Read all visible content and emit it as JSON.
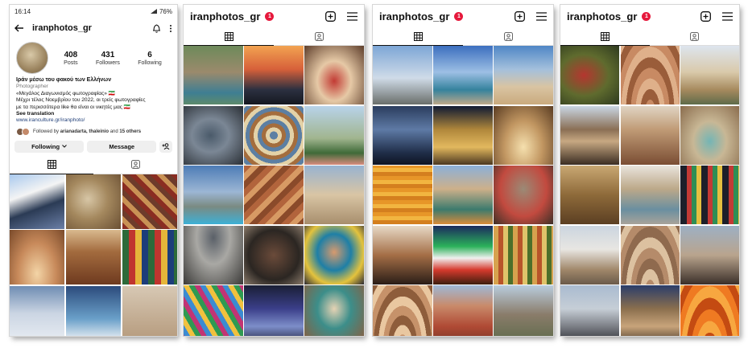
{
  "status": {
    "time": "16:14",
    "battery": "76%"
  },
  "profile": {
    "username": "iranphotos_gr",
    "stats": [
      {
        "num": "408",
        "label": "Posts"
      },
      {
        "num": "431",
        "label": "Followers"
      },
      {
        "num": "6",
        "label": "Following"
      }
    ],
    "bio_name": "Ιράν μέσω του φακού των Ελλήνων",
    "category": "Photographer",
    "bio_lines": [
      "«Μεγάλος Διαγωνισμός φωτογραφίας» 🇮🇷",
      "Μέχρι τέλος Νοεμβρίου του 2022, οι τρείς φωτογραφίες",
      "με τα περισσότερα like θα είναι οι νικητές μας 🇮🇷"
    ],
    "see_translation": "See translation",
    "link": "www.iranculture.gr/iranphoto/",
    "followed_prefix": "Followed by ",
    "followed_names": "arianadarta, thaleinio",
    "followed_mid": " and ",
    "followed_others": "15 others",
    "following_button": "Following",
    "message_button": "Message"
  },
  "feeds": [
    {
      "username": "iranphotos_gr",
      "badge": "1"
    },
    {
      "username": "iranphotos_gr",
      "badge": "1"
    },
    {
      "username": "iranphotos_gr",
      "badge": "1"
    }
  ],
  "colors": {
    "accent_red": "#e6193c",
    "link_blue": "#24427a",
    "button_gray": "#efefef"
  },
  "icons": [
    "back-arrow-icon",
    "bell-icon",
    "more-icon",
    "grid-icon",
    "tagged-icon",
    "add-post-icon",
    "menu-icon",
    "add-person-icon",
    "chevron-down-icon"
  ],
  "thumbnails": {
    "p1": [
      "linear-gradient(160deg,#a9c9ee 0%,#f4f4f4 35%,#2b3b55 60%,#6b7fa7 100%)",
      "radial-gradient(circle at 40% 45%,#d7c6a6 0%,#a4885e 45%,#6a4f33 100%)",
      "repeating-linear-gradient(45deg,#8a2d22 0 6px,#c99255 6px 12px,#6d3b2b 12px 18px)",
      "radial-gradient(ellipse at 50% 80%,#f3d4a6 0%,#c7895a 50%,#7a4a2a 100%)",
      "linear-gradient(180deg,#d9b98e 0%,#a36b3e 40%,#6e3a1f 100%)",
      "repeating-linear-gradient(90deg,#2d6a3a 0 8px,#c0352f 8px 16px,#e5b63a 16px 24px,#1c3d7a 24px 32px)",
      "linear-gradient(180deg,#6f8db3 0%,#cbd5e3 50%,#e7ecf2 100%)",
      "linear-gradient(180deg,#2c4b7c 0%,#6aa0c9 60%,#f0f3f6 100%)",
      "linear-gradient(180deg,#d7c8b4 0%,#b59a7c 100%)"
    ],
    "p2": [
      "linear-gradient(180deg,#6d8a5a 0%,#9b8a6c 45%,#3e7e93 80%,#5d8a6b 100%)",
      "linear-gradient(180deg,#f2a351 0%,#d7603a 40%,#2b3040 75%,#151820 100%)",
      "radial-gradient(ellipse at 50% 60%,#c23b34 0%,#e6c9a6 40%,#5d3d2a 100%)",
      "radial-gradient(ellipse at 45% 50%,#4a5a6a 0%,#7b8795 40%,#2a2f35 100%)",
      "repeating-radial-gradient(circle at 50% 50%,#5c7fa3 0 5px,#e3d2a8 5px 10px,#a46d3d 10px 15px)",
      "linear-gradient(180deg,#b8d3ea 0%,#a1b58f 55%,#3f6a38 80%,#d78b7d 100%)",
      "linear-gradient(180deg,#4d7cb6 0%,#9cb6d4 45%,#7a8a82 70%,#3db0d6 100%)",
      "repeating-linear-gradient(135deg,#b2643c 0 7px,#d79a64 7px 14px,#8a4a2a 14px 21px)",
      "linear-gradient(180deg,#98b3d1 0%,#d9c5a4 50%,#a78e6d 100%)",
      "radial-gradient(ellipse at 50% 20%,#5a6068 0%,#a9a8a4 40%,#3b3a38 100%)",
      "radial-gradient(ellipse at 50% 50%,#6b4b3a 0%,#2b2622 60%,#8a7a6a 100%)",
      "radial-gradient(ellipse at 50% 45%,#d79a6e 0%,#1e7fa6 40%,#e4c33d 70%,#2b2a35 100%)",
      "repeating-linear-gradient(60deg,#c23474 0 6px,#3c8bd1 6px 12px,#f1c13e 12px 18px,#2f9a52 18px 24px)",
      "linear-gradient(180deg,#1a1f35 0%,#3b3f8a 40%,#7d8ec9 70%,#212340 100%)",
      "radial-gradient(ellipse at 50% 40%,#e6d3b4 0%,#3c8e8a 40%,#8e5a3a 100%)"
    ],
    "p3": [
      "linear-gradient(180deg,#7da6d6 0%,#cfdbe8 55%,#6a6e6a 100%)",
      "linear-gradient(180deg,#3c6fbf 0%,#9dbfe4 45%,#35829d 75%,#bda88a 100%)",
      "linear-gradient(180deg,#4f86c6 0%,#a4c0dc 40%,#d9c4a2 70%,#c9aa7e 100%)",
      "linear-gradient(180deg,#2b3d5e 0%,#5e7aa5 40%,#1f2d48 80%,#0e1422 100%)",
      "linear-gradient(180deg,#0f1a33 0%,#b0873b 40%,#e2b85e 70%,#4b3720 100%)",
      "radial-gradient(ellipse at 50% 70%,#f5e0ae 0%,#c29762 45%,#5a3c22 100%)",
      "repeating-linear-gradient(0deg,#d47f1e 0 5px,#f2b540 5px 10px,#e79628 10px 15px)",
      "linear-gradient(180deg,#8cb0d8 0%,#cdb08a 40%,#3c7a6d 75%,#d98b3a 100%)",
      "radial-gradient(ellipse at 50% 40%,#9b8a76 0%,#c24a3f 55%,#3d3027 100%)",
      "linear-gradient(180deg,#e7d9c6 0%,#a46e46 50%,#2a1d17 100%)",
      "linear-gradient(180deg,#1b2a5e 0%,#2bb15a 35%,#f0f0f0 55%,#d63a2d 75%,#3d1e0e 100%)",
      "repeating-linear-gradient(90deg,#d7a24e 0 6px,#b8542a 6px 12px,#e0c36a 12px 18px,#4d6f2a 18px 24px)",
      "repeating-radial-gradient(ellipse at 50% 100%,#c6926a 0 6px,#e9c7a0 6px 12px,#8e5d3b 12px 18px)",
      "linear-gradient(180deg,#9fb8d6 0%,#c98a6a 35%,#b04a35 70%,#7a3626 100%)",
      "linear-gradient(180deg,#b9ccdd 0%,#8a7c6a 50%,#5c6a4a 100%)"
    ],
    "p4": [
      "radial-gradient(ellipse at 40% 50%,#b5362f 0%,#5f6b2e 50%,#2e3a1f 100%)",
      "repeating-radial-gradient(ellipse at 50% 110%,#c88a63 0 6px,#9a5d3a 6px 12px,#dfb08a 12px 18px)",
      "linear-gradient(180deg,#dde5ee 0%,#d9c9aa 45%,#a68a5e 75%,#5e6b4a 100%)",
      "linear-gradient(180deg,#c9d6e4 0%,#8a6f55 40%,#c7a882 60%,#3b2d22 100%)",
      "linear-gradient(180deg,#e0d4c3 0%,#c09b76 40%,#7a4d33 100%)",
      "radial-gradient(ellipse at 50% 60%,#74b5b5 0%,#c8b795 40%,#8a6c4d 100%)",
      "linear-gradient(180deg,#c9a873 0%,#8e6a3a 50%,#5b3f22 100%)",
      "linear-gradient(180deg,#e9e4dc 0%,#bca889 40%,#6a8fa0 75%,#a9a39a 100%)",
      "repeating-linear-gradient(90deg,#1c1f2a 0 8px,#c23a35 8px 14px,#2e8e55 14px 20px,#e4c040 20px 26px)",
      "linear-gradient(180deg,#cbd5df 0%,#e8e6e2 40%,#a0876a 75%,#6a5a4a 100%)",
      "repeating-radial-gradient(ellipse at 50% 110%,#b58b6a 0 6px,#dcc1a0 6px 12px,#8f6a4e 12px 18px)",
      "linear-gradient(180deg,#9db0c4 0%,#b9a48d 50%,#3a2f29 100%)",
      "linear-gradient(180deg,#a9bbd0 0%,#c6ced6 40%,#7c7f86 70%,#2a2d33 100%)",
      "linear-gradient(180deg,#2a3d6a 0%,#8b6f4e 40%,#c8a47a 70%,#4a3a2c 100%)",
      "repeating-radial-gradient(ellipse at 50% 120%,#ef7a22 0 6px,#c44b12 6px 12px,#f7a740 12px 18px)"
    ]
  }
}
